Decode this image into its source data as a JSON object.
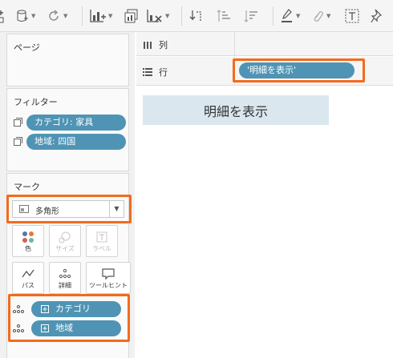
{
  "toolbar": {
    "icons": [
      "new-worksheet-icon",
      "data-source-icon",
      "refresh-icon",
      "chart-add-icon",
      "duplicate-icon",
      "clear-icon",
      "swap-icon",
      "sort-ascending-icon",
      "sort-descending-icon",
      "highlight-icon",
      "attach-icon",
      "text-icon",
      "pin-icon"
    ]
  },
  "pages": {
    "title": "ページ"
  },
  "filters": {
    "title": "フィルター",
    "items": [
      "カテゴリ: 家具",
      "地域: 四国"
    ]
  },
  "marks": {
    "title": "マーク",
    "mark_type": "多角形",
    "buttons": [
      {
        "label": "色",
        "disabled": false
      },
      {
        "label": "サイズ",
        "disabled": true
      },
      {
        "label": "ラベル",
        "disabled": true
      },
      {
        "label": "パス",
        "disabled": false
      },
      {
        "label": "詳細",
        "disabled": false
      },
      {
        "label": "ツールヒント",
        "disabled": false
      }
    ],
    "fields": [
      "カテゴリ",
      "地域"
    ]
  },
  "columns": {
    "label": "列"
  },
  "rows": {
    "label": "行",
    "pill": "'明細を表示'"
  },
  "sheet": {
    "title": "明細を表示"
  },
  "colors": {
    "pill": "#4f94b4",
    "highlight": "#f26b1d",
    "title_bg": "#dbe7ee"
  }
}
